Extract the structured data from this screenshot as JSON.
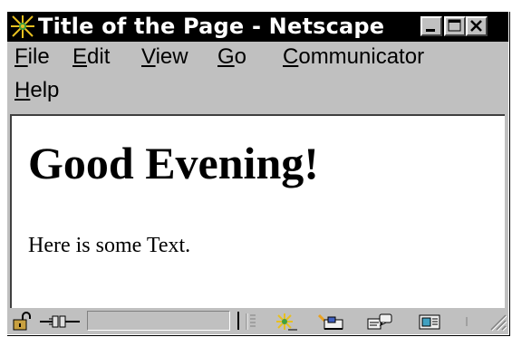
{
  "window": {
    "title": "Title of the Page - Netscape",
    "app_icon": "netscape-logo-icon",
    "controls": {
      "minimize": "minimize-icon",
      "maximize": "maximize-icon",
      "close": "close-icon"
    }
  },
  "menubar": {
    "items": [
      {
        "key": "F",
        "rest": "ile"
      },
      {
        "key": "E",
        "rest": "dit"
      },
      {
        "key": "V",
        "rest": "iew"
      },
      {
        "key": "G",
        "rest": "o"
      },
      {
        "key": "C",
        "rest": "ommunicator"
      },
      {
        "key": "H",
        "rest": "elp"
      }
    ]
  },
  "page": {
    "heading": "Good Evening!",
    "paragraph": "Here is some Text."
  },
  "statusbar": {
    "icons": [
      "security-lock-icon",
      "online-connection-icon",
      "component-navigator-icon",
      "mailbox-icon",
      "discussion-icon",
      "composer-icon"
    ]
  },
  "colors": {
    "titlebar_bg": "#000000",
    "titlebar_text": "#ffffff",
    "chrome": "#c0c0c0",
    "content_bg": "#ffffff"
  }
}
